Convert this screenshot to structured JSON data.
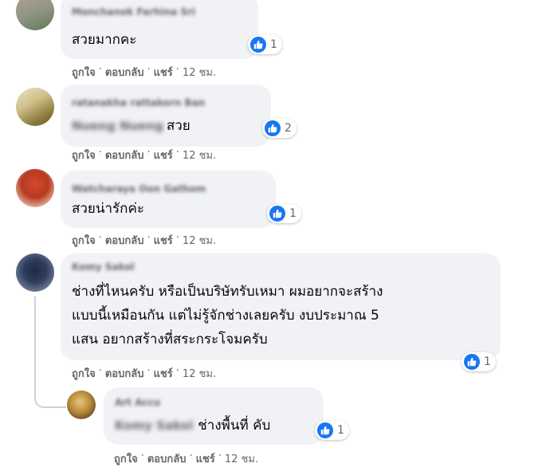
{
  "comments": [
    {
      "author": "Monchanok Farhina Sri",
      "text": "สวยมากคะ",
      "reactions": "1",
      "actions": {
        "like": "ถูกใจ",
        "reply": "ตอบกลับ",
        "share": "แชร์",
        "time": "12 ชม."
      }
    },
    {
      "author": "ratanakha rattakorn Ban",
      "tag": "Nueng Nueng",
      "text": "สวย",
      "reactions": "2",
      "actions": {
        "like": "ถูกใจ",
        "reply": "ตอบกลับ",
        "share": "แชร์",
        "time": "12 ชม."
      }
    },
    {
      "author": "Watcharaya Oon Gathom",
      "text": "สวยน่ารักค่ะ",
      "reactions": "1",
      "actions": {
        "like": "ถูกใจ",
        "reply": "ตอบกลับ",
        "share": "แชร์",
        "time": "12 ชม."
      }
    },
    {
      "author": "Komy Sakol",
      "text_lines": [
        "ช่างที่ไหนครับ หรือเป็นบริษัทรับเหมา ผมอยากจะสร้าง",
        "แบบนี้เหมือนกัน แต่ไม่รู้จักช่างเลยครับ งบประมาณ 5",
        "แสน อยากสร้างที่สระกระโจมครับ"
      ],
      "reactions": "1",
      "actions": {
        "like": "ถูกใจ",
        "reply": "ตอบกลับ",
        "share": "แชร์",
        "time": "12 ชม."
      }
    }
  ],
  "reply": {
    "author": "Art Accu",
    "tag": "Komy Sakol",
    "text": "ช่างพื้นที่ คับ",
    "reactions": "1",
    "actions": {
      "like": "ถูกใจ",
      "reply": "ตอบกลับ",
      "share": "แชร์",
      "time": "12 ชม."
    }
  },
  "colors": {
    "like_blue": "#1877f2",
    "bubble_bg": "#f0f2f5",
    "meta_text": "#65676b"
  },
  "icons": [
    "like-thumb-icon"
  ]
}
